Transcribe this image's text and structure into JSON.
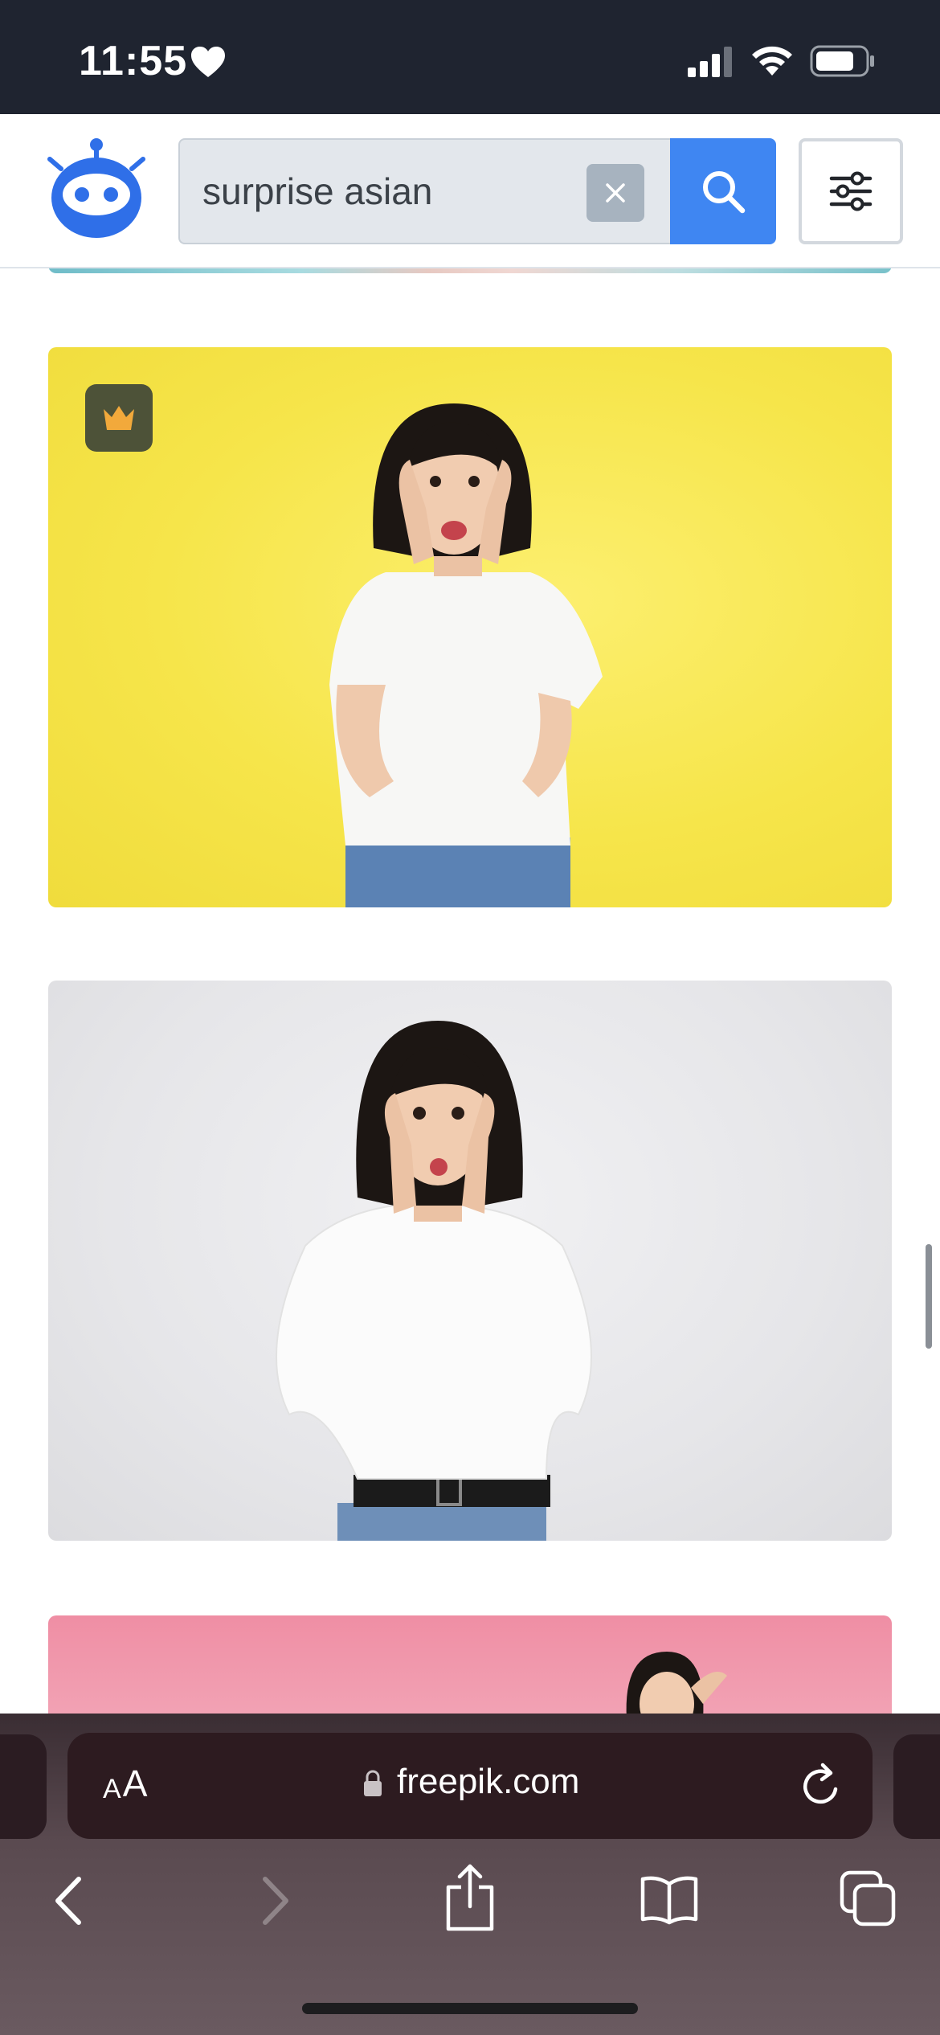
{
  "status_bar": {
    "time": "11:55",
    "heart_icon": "heart-icon",
    "signal_icon": "cellular-signal-icon",
    "wifi_icon": "wifi-icon",
    "battery_icon": "battery-icon"
  },
  "header": {
    "logo_icon": "robot-logo-icon",
    "search": {
      "value": "surprise asian",
      "clear_icon": "close-icon",
      "submit_icon": "search-icon"
    },
    "filters_icon": "sliders-icon"
  },
  "results": {
    "cards": [
      {
        "kind": "partial",
        "background": "#8ccfd6"
      },
      {
        "kind": "photo",
        "background": "#f6e54a",
        "premium": true,
        "premium_icon": "crown-icon",
        "premium_badge_color": "#4d5238",
        "premium_icon_color": "#f2a93b"
      },
      {
        "kind": "photo",
        "background": "#e6e6e9",
        "premium": false
      },
      {
        "kind": "partial",
        "background": "#f2a3b5"
      }
    ]
  },
  "browser": {
    "text_size_label_small": "A",
    "text_size_label_large": "A",
    "url": "freepik.com",
    "lock_icon": "lock-icon",
    "reload_icon": "reload-icon",
    "nav": {
      "back_icon": "chevron-left-icon",
      "forward_icon": "chevron-right-icon",
      "share_icon": "share-icon",
      "bookmarks_icon": "book-icon",
      "tabs_icon": "tabs-icon"
    }
  },
  "colors": {
    "accent": "#3f86f2",
    "status_bar_bg": "#1f2430",
    "toolbar_bg": "#5a4a50",
    "address_bar_bg": "#2d1b20"
  }
}
